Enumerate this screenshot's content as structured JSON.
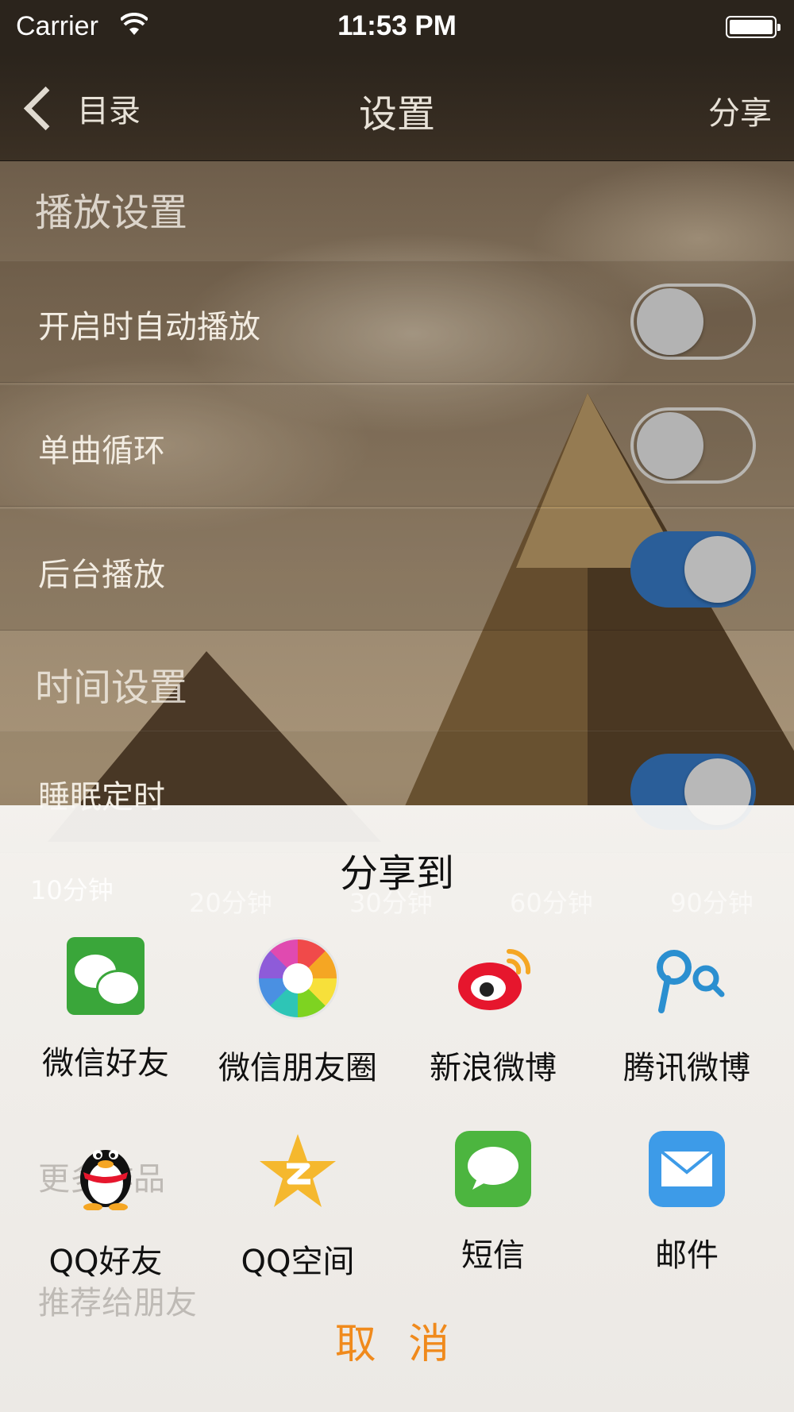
{
  "status_bar": {
    "carrier": "Carrier",
    "time": "11:53 PM"
  },
  "nav": {
    "back_label": "目录",
    "title": "设置",
    "share_label": "分享"
  },
  "playback": {
    "section_title": "播放设置",
    "rows": [
      {
        "label": "开启时自动播放",
        "on": false
      },
      {
        "label": "单曲循环",
        "on": false
      },
      {
        "label": "后台播放",
        "on": true
      }
    ]
  },
  "time_settings": {
    "section_title": "时间设置",
    "sleep_timer": {
      "label": "睡眠定时",
      "on": true
    },
    "durations": [
      "10分钟",
      "20分钟",
      "30分钟",
      "60分钟",
      "90分钟"
    ],
    "selected_index": 0
  },
  "obscured_rows": [
    "更多作品",
    "推荐给朋友"
  ],
  "share_sheet": {
    "title": "分享到",
    "targets": [
      {
        "label": "微信好友",
        "icon": "wechat-icon"
      },
      {
        "label": "微信朋友圈",
        "icon": "wechat-moments-icon"
      },
      {
        "label": "新浪微博",
        "icon": "sina-weibo-icon"
      },
      {
        "label": "腾讯微博",
        "icon": "tencent-weibo-icon"
      },
      {
        "label": "QQ好友",
        "icon": "qq-penguin-icon"
      },
      {
        "label": "QQ空间",
        "icon": "qzone-star-icon"
      },
      {
        "label": "短信",
        "icon": "messages-icon"
      },
      {
        "label": "邮件",
        "icon": "mail-icon"
      }
    ],
    "cancel_label": "取 消"
  },
  "colors": {
    "accent_orange": "#f08a1c",
    "toggle_on": "#2a5e99",
    "nav_bg": "#2b241c"
  }
}
